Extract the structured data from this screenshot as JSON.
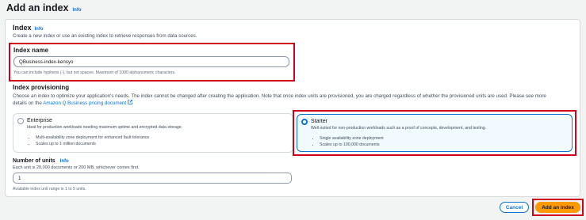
{
  "header": {
    "title": "Add an index",
    "info": "Info"
  },
  "index_section": {
    "title": "Index",
    "info": "Info",
    "description": "Create a new index or use an existing index to retrieve responses from data sources."
  },
  "index_name": {
    "label": "Index name",
    "value": "QBusiness-index-kensyo",
    "hint": "You can include hyphens (-), but not spaces. Maximum of 1000 alphanumeric characters."
  },
  "provisioning": {
    "title": "Index provisioning",
    "description_line1": "Choose an index to optimize your application's needs. The index cannot be changed after creating the application. Note that once index units are provisioned, you are charged regardless of whether the provisioned units are used. Please see more",
    "description_prefix": "details on the ",
    "pricing_link": "Amazon Q Business pricing document",
    "options": [
      {
        "title": "Enterprise",
        "description": "Ideal for production workloads needing maximum uptime and encrypted data storage.",
        "bullets": [
          "Multi-availability zone deployment for enhanced fault tolerance",
          "Scales up to 1 million documents"
        ],
        "selected": false
      },
      {
        "title": "Starter",
        "description": "Well-suited for non-production workloads such as a proof of concepts, development, and testing.",
        "bullets": [
          "Single availability zone deployment",
          "Scales up to 100,000 documents"
        ],
        "selected": true
      }
    ]
  },
  "units": {
    "label": "Number of units",
    "info": "Info",
    "description": "Each unit is 20,000 documents or 200 MB, whichever comes first.",
    "value": "1",
    "hint": "Available index unit range is 1 to 5 units."
  },
  "actions": {
    "cancel": "Cancel",
    "primary": "Add an index"
  },
  "colors": {
    "accent": "#0972d3",
    "primary_button": "#ff9900",
    "highlight": "#d0021b"
  }
}
